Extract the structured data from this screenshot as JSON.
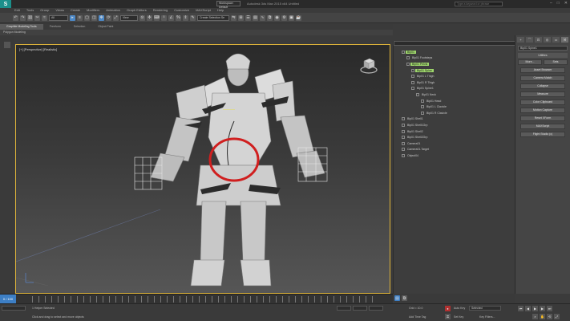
{
  "app": {
    "logo": "S",
    "title": "Autodesk 3ds Max 2015 x64    Untitled",
    "workspace": "Workspace: Default",
    "search_placeholder": "Type a keyword or phrase",
    "win_controls": [
      "–",
      "□",
      "✕"
    ]
  },
  "menu": [
    "Edit",
    "Tools",
    "Group",
    "Views",
    "Create",
    "Modifiers",
    "Animation",
    "Graph Editors",
    "Rendering",
    "Customize",
    "MAXScript",
    "Help"
  ],
  "toolbar": {
    "selection_filter": "All",
    "ref_coord": "View",
    "named_set": "Create Selection Se"
  },
  "ribbon": {
    "tabs": [
      "Graphite Modeling Tools",
      "Freeform",
      "Selection",
      "Object Paint"
    ],
    "active_tab": 0,
    "sub_label": "Polygon Modeling"
  },
  "viewport": {
    "label": "[+] [Perspective] [Realistic]",
    "accent": "#e0b53a"
  },
  "scene_explorer": {
    "items": [
      {
        "label": "Bip01",
        "indent": 1,
        "selected": true
      },
      {
        "label": "Bip01 Footsteps",
        "indent": 2,
        "selected": false
      },
      {
        "label": "Bip01 Pelvis",
        "indent": 2,
        "selected": true
      },
      {
        "label": "Bip01 Spine",
        "indent": 3,
        "selected": true
      },
      {
        "label": "Bip01 L Thigh",
        "indent": 3,
        "selected": false
      },
      {
        "label": "Bip01 R Thigh",
        "indent": 3,
        "selected": false
      },
      {
        "label": "Bip01 Spine1",
        "indent": 3,
        "selected": false
      },
      {
        "label": "Bip01 Neck",
        "indent": 4,
        "selected": false
      },
      {
        "label": "Bip01 Head",
        "indent": 5,
        "selected": false
      },
      {
        "label": "Bip01 L Clavicle",
        "indent": 5,
        "selected": false
      },
      {
        "label": "Bip01 R Clavicle",
        "indent": 5,
        "selected": false
      },
      {
        "label": "Bip01 Shell1",
        "indent": 1,
        "selected": false
      },
      {
        "label": "Bip01 Shell1Grp",
        "indent": 1,
        "selected": false
      },
      {
        "label": "Bip01 Shell2",
        "indent": 1,
        "selected": false
      },
      {
        "label": "Bip01 Shell2Grp",
        "indent": 1,
        "selected": false
      },
      {
        "label": "Camera01",
        "indent": 1,
        "selected": false
      },
      {
        "label": "Camera01.Target",
        "indent": 1,
        "selected": false
      },
      {
        "label": "Object04",
        "indent": 1,
        "selected": false
      }
    ]
  },
  "command_panel": {
    "tabs": [
      "+",
      "⌒",
      "⊡",
      "◎",
      "▭",
      "⚒"
    ],
    "active_tab": 5,
    "object_name": "Bip01 Spine1",
    "rollout": "Utilities",
    "more_label": "More...",
    "sets_label": "Sets",
    "buttons": [
      "Asset Browser",
      "Camera Match",
      "Collapse",
      "Measure",
      "Color Clipboard",
      "Motion Capture",
      "Reset XForm",
      "MAXScript",
      "Flight Studio (c)"
    ]
  },
  "timeline": {
    "frame": "0 / 100"
  },
  "status": {
    "selected": "1 Helper Selected",
    "prompt": "Click and drag to select and move objects",
    "auto_key": "Auto Key",
    "selected_field": "Selected",
    "set_key": "Set Key",
    "key_filters": "Key Filters...",
    "add_time_tag": "Add Time Tag",
    "grid": "Grid = 10.0"
  }
}
